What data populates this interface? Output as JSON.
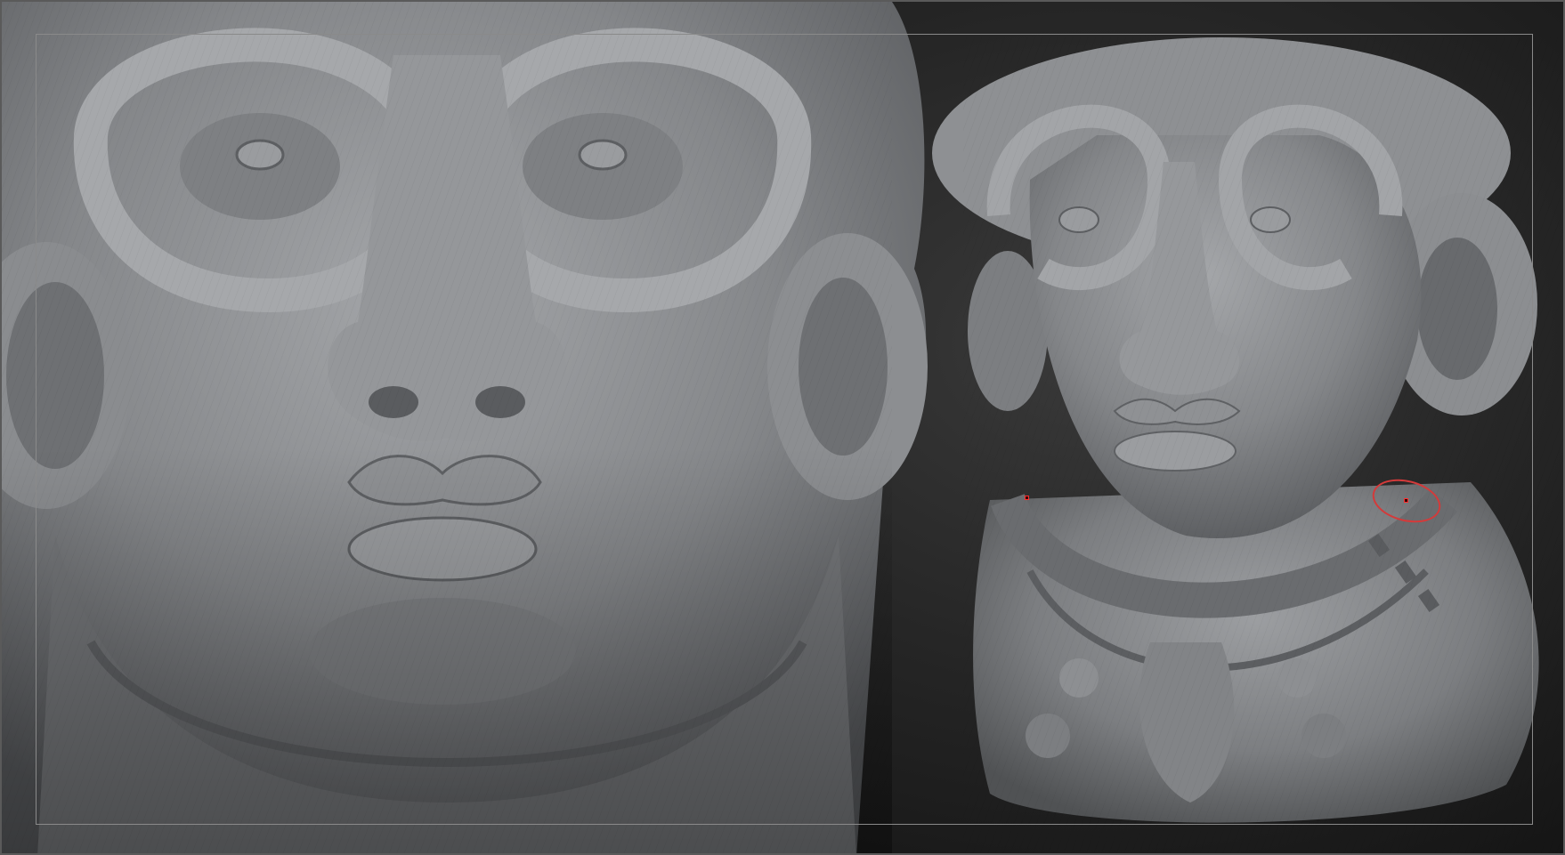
{
  "app": {
    "name": ""
  },
  "viewport": {
    "background_color": "#262626",
    "model_color": "#8a8c8f"
  },
  "views": [
    {
      "name": "close-up-view"
    },
    {
      "name": "full-bust-view"
    }
  ],
  "brush": {
    "cursor_color": "#d43a3a"
  }
}
